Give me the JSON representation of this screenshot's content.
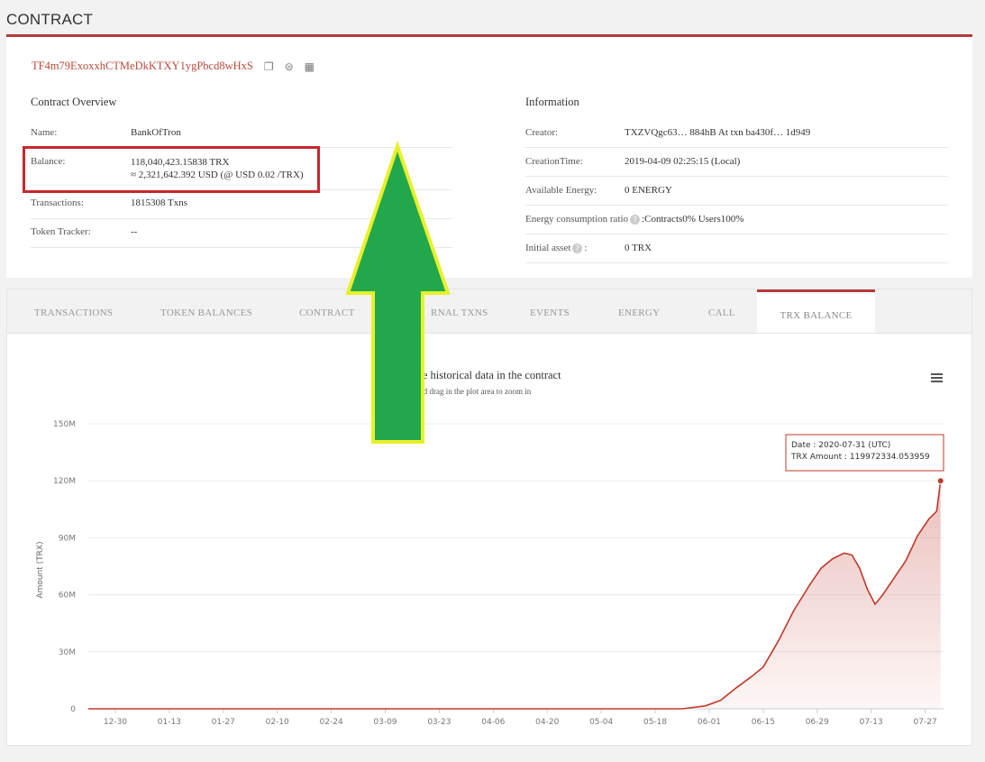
{
  "page": {
    "title": "CONTRACT"
  },
  "contract": {
    "address": "TF4m79ExoxxhCTMeDkKTXY1ygPbcd8wHxS"
  },
  "overview": {
    "heading": "Contract Overview",
    "name_label": "Name:",
    "name_value": "BankOfTron",
    "balance_label": "Balance:",
    "balance_trx": "118,040,423.15838 TRX",
    "balance_usd": "≈ 2,321,642.392 USD (@ USD 0.02 /TRX)",
    "transactions_label": "Transactions:",
    "transactions_value": "1815308  Txns",
    "token_tracker_label": "Token Tracker:",
    "token_tracker_value": "--"
  },
  "information": {
    "heading": "Information",
    "creator_label": "Creator:",
    "creator_value": "TXZVQgc63… 884hB At txn ba430f… 1d949",
    "creation_time_label": "CreationTime:",
    "creation_time_value": "2019-04-09 02:25:15 (Local)",
    "available_energy_label": "Available Energy:",
    "available_energy_value": "0  ENERGY",
    "energy_ratio_label": "Energy consumption ratio",
    "energy_ratio_value": ":Contracts0%  Users100%",
    "initial_asset_label": "Initial asset",
    "initial_asset_value": "0 TRX"
  },
  "tabs": [
    {
      "label": "TRANSACTIONS"
    },
    {
      "label": "TOKEN BALANCES"
    },
    {
      "label": "CONTRACT"
    },
    {
      "label": "RNAL TXNS"
    },
    {
      "label": "EVENTS"
    },
    {
      "label": "ENERGY"
    },
    {
      "label": "CALL"
    },
    {
      "label": "TRX BALANCE"
    }
  ],
  "active_tab": "TRX BALANCE",
  "annotation": {
    "arrow_fill": "#22a84a",
    "arrow_stroke": "#e8f02a",
    "box_color": "#c8282e"
  },
  "chart_data": {
    "type": "area",
    "title": "lance historical data in the contract",
    "subtitle": "ick and drag in the plot area to zoom in",
    "ylabel": "Amount (TRX)",
    "ylim": [
      0,
      150000000
    ],
    "yticks": [
      "0",
      "30M",
      "60M",
      "90M",
      "120M",
      "150M"
    ],
    "xticks": [
      "12-30",
      "01-13",
      "01-27",
      "02-10",
      "02-24",
      "03-09",
      "03-23",
      "04-06",
      "04-20",
      "05-04",
      "05-18",
      "06-01",
      "06-15",
      "06-29",
      "07-13",
      "07-27"
    ],
    "series": [
      {
        "color": "#c0392b",
        "points": [
          [
            "2019-12-23",
            0
          ],
          [
            "2020-05-20",
            0
          ],
          [
            "2020-05-25",
            0
          ],
          [
            "2020-05-31",
            1500000
          ],
          [
            "2020-06-04",
            4500000
          ],
          [
            "2020-06-08",
            11000000
          ],
          [
            "2020-06-12",
            17000000
          ],
          [
            "2020-06-15",
            22000000
          ],
          [
            "2020-06-19",
            36000000
          ],
          [
            "2020-06-23",
            52000000
          ],
          [
            "2020-06-27",
            65000000
          ],
          [
            "2020-06-30",
            74000000
          ],
          [
            "2020-07-03",
            79000000
          ],
          [
            "2020-07-06",
            82000000
          ],
          [
            "2020-07-08",
            81000000
          ],
          [
            "2020-07-10",
            74000000
          ],
          [
            "2020-07-12",
            63000000
          ],
          [
            "2020-07-14",
            55000000
          ],
          [
            "2020-07-16",
            60000000
          ],
          [
            "2020-07-19",
            69000000
          ],
          [
            "2020-07-22",
            78000000
          ],
          [
            "2020-07-25",
            91000000
          ],
          [
            "2020-07-28",
            100000000
          ],
          [
            "2020-07-30",
            104000000
          ],
          [
            "2020-07-31",
            119972334
          ]
        ]
      }
    ],
    "tooltip": {
      "date": "Date : 2020-07-31 (UTC)",
      "amount": "TRX Amount : 119972334.053959"
    }
  }
}
